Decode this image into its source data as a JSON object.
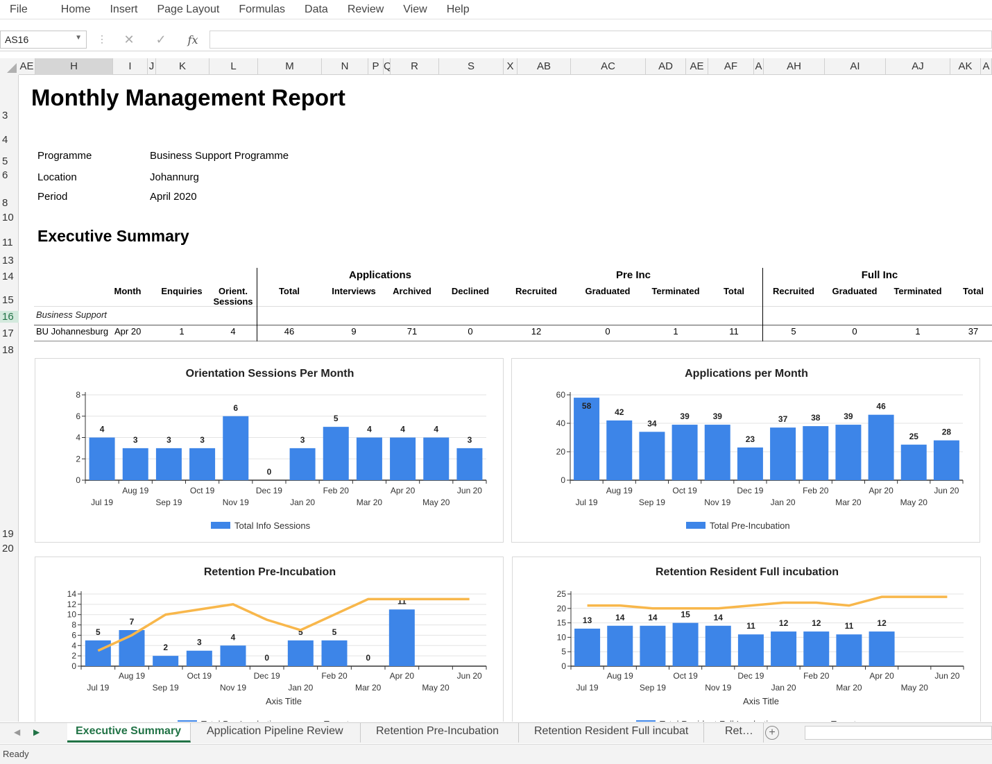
{
  "menu": [
    "File",
    "Home",
    "Insert",
    "Page Layout",
    "Formulas",
    "Data",
    "Review",
    "View",
    "Help"
  ],
  "formula_bar": {
    "name_box": "AS16",
    "fx_label": "fx"
  },
  "columns": [
    "AE",
    "H",
    "I",
    "J",
    "K",
    "L",
    "M",
    "N",
    "P",
    "Q",
    "R",
    "S",
    "X",
    "AB",
    "AC",
    "AD",
    "AE",
    "AF",
    "A",
    "AH",
    "AI",
    "AJ",
    "AK",
    "A"
  ],
  "rows": [
    "3",
    "4",
    "5",
    "6",
    "8",
    "10",
    "11",
    "13",
    "14",
    "15",
    "16",
    "17",
    "18",
    "19",
    "20"
  ],
  "report": {
    "title": "Monthly Management Report",
    "fields": [
      {
        "label": "Programme",
        "value": "Business Support Programme"
      },
      {
        "label": "Location",
        "value": "Johannurg"
      },
      {
        "label": "Period",
        "value": "April 2020"
      }
    ],
    "section_title": "Executive Summary"
  },
  "summary_table": {
    "group_headers": {
      "applications": "Applications",
      "pre_inc": "Pre Inc",
      "full_inc": "Full Inc"
    },
    "headers": [
      "Month",
      "Enquiries",
      "Orient. Sessions",
      "Total",
      "Interviews",
      "Archived",
      "Declined",
      "Recruited",
      "Graduated",
      "Terminated",
      "Total",
      "Recruited",
      "Graduated",
      "Terminated",
      "Total"
    ],
    "group_row": "Business Support",
    "row": {
      "name": "BU Johannesburg",
      "values": [
        "Apr 20",
        "1",
        "4",
        "46",
        "9",
        "71",
        "0",
        "12",
        "0",
        "1",
        "11",
        "5",
        "0",
        "1",
        "37"
      ]
    }
  },
  "chart_data": [
    {
      "type": "bar",
      "title": "Orientation Sessions Per Month",
      "categories": [
        "Jul 19",
        "Aug 19",
        "Sep 19",
        "Oct 19",
        "Nov 19",
        "Dec 19",
        "Jan 20",
        "Feb 20",
        "Mar 20",
        "Apr 20",
        "May 20",
        "Jun 20"
      ],
      "series": [
        {
          "name": "Total Info Sessions",
          "values": [
            4,
            3,
            3,
            3,
            6,
            0,
            3,
            5,
            4,
            4,
            4,
            3
          ]
        }
      ],
      "ylim": [
        0,
        8
      ],
      "yticks": [
        0,
        2,
        4,
        6,
        8
      ],
      "color": "#3d85e8",
      "legend": "bottom"
    },
    {
      "type": "bar",
      "title": "Applications per Month",
      "categories": [
        "Jul 19",
        "Aug 19",
        "Sep 19",
        "Oct 19",
        "Nov 19",
        "Dec 19",
        "Jan 20",
        "Feb 20",
        "Mar 20",
        "Apr 20",
        "May 20",
        "Jun 20"
      ],
      "series": [
        {
          "name": "Total Pre-Incubation",
          "values": [
            58,
            42,
            34,
            39,
            39,
            23,
            37,
            38,
            39,
            46,
            25,
            28
          ]
        }
      ],
      "ylim": [
        0,
        60
      ],
      "yticks": [
        0,
        20,
        40,
        60
      ],
      "color": "#3d85e8",
      "legend": "bottom"
    },
    {
      "type": "bar",
      "title": "Retention Pre-Incubation",
      "xlabel": "Axis Title",
      "categories": [
        "Jul 19",
        "Aug 19",
        "Sep 19",
        "Oct 19",
        "Nov 19",
        "Dec 19",
        "Jan 20",
        "Feb 20",
        "Mar 20",
        "Apr 20",
        "May 20",
        "Jun 20"
      ],
      "series": [
        {
          "name": "Total Pre-Incubation",
          "values": [
            5,
            7,
            2,
            3,
            4,
            0,
            5,
            5,
            0,
            11,
            null,
            null
          ]
        },
        {
          "name": "Target",
          "type": "line",
          "values": [
            3,
            6,
            10,
            11,
            12,
            9,
            7,
            10,
            13,
            13,
            13,
            13
          ]
        }
      ],
      "ylim": [
        0,
        14
      ],
      "yticks": [
        0,
        2,
        4,
        6,
        8,
        10,
        12,
        14
      ],
      "color": "#3d85e8",
      "line_color": "#f8b74b",
      "legend": "bottom"
    },
    {
      "type": "bar",
      "title": "Retention Resident Full incubation",
      "xlabel": "Axis Title",
      "categories": [
        "Jul 19",
        "Aug 19",
        "Sep 19",
        "Oct 19",
        "Nov 19",
        "Dec 19",
        "Jan 20",
        "Feb 20",
        "Mar 20",
        "Apr 20",
        "May 20",
        "Jun 20"
      ],
      "series": [
        {
          "name": "Total Resident Full Incubation",
          "values": [
            13,
            14,
            14,
            15,
            14,
            11,
            12,
            12,
            11,
            12,
            null,
            null
          ]
        },
        {
          "name": "Target",
          "type": "line",
          "values": [
            21,
            21,
            20,
            20,
            20,
            21,
            22,
            22,
            21,
            24,
            24,
            24
          ]
        }
      ],
      "ylim": [
        0,
        25
      ],
      "yticks": [
        0,
        5,
        10,
        15,
        20,
        25
      ],
      "color": "#3d85e8",
      "line_color": "#f8b74b",
      "legend": "bottom"
    }
  ],
  "sheet_tabs": [
    "Executive Summary",
    "Application Pipeline Review",
    "Retention Pre-Incubation",
    "Retention Resident Full incubat",
    "Ret…"
  ],
  "status": "Ready"
}
